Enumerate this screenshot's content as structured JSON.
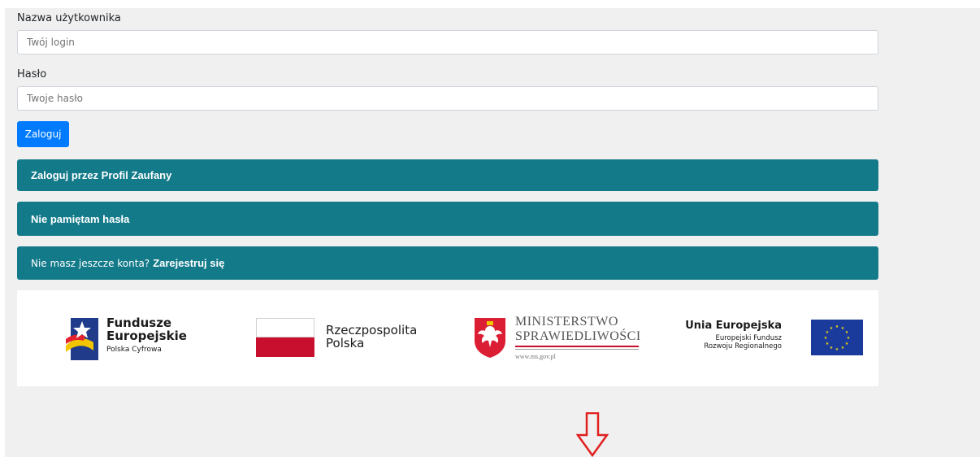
{
  "form": {
    "username_label": "Nazwa użytkownika",
    "username_placeholder": "Twój login",
    "password_label": "Hasło",
    "password_placeholder": "Twoje hasło",
    "login_button": "Zaloguj"
  },
  "actions": {
    "profil_zaufany": "Zaloguj przez Profil Zaufany",
    "forgot_password": "Nie pamiętam hasła",
    "no_account_text": "Nie masz jeszcze konta?",
    "register_link": "Zarejestruj się"
  },
  "logos": {
    "fe_line1": "Fundusze",
    "fe_line2": "Europejskie",
    "fe_line3": "Polska Cyfrowa",
    "rp_line1": "Rzeczpospolita",
    "rp_line2": "Polska",
    "ms_line1": "MINISTERSTWO",
    "ms_line2": "SPRAWIEDLIWOŚCI",
    "ms_line3": "www.ms.gov.pl",
    "ue_line1": "Unia Europejska",
    "ue_line2": "Europejski Fundusz",
    "ue_line3": "Rozwoju Regionalnego"
  },
  "colors": {
    "primary": "#007bff",
    "teal": "#137a8a",
    "arrow": "#e02020"
  }
}
